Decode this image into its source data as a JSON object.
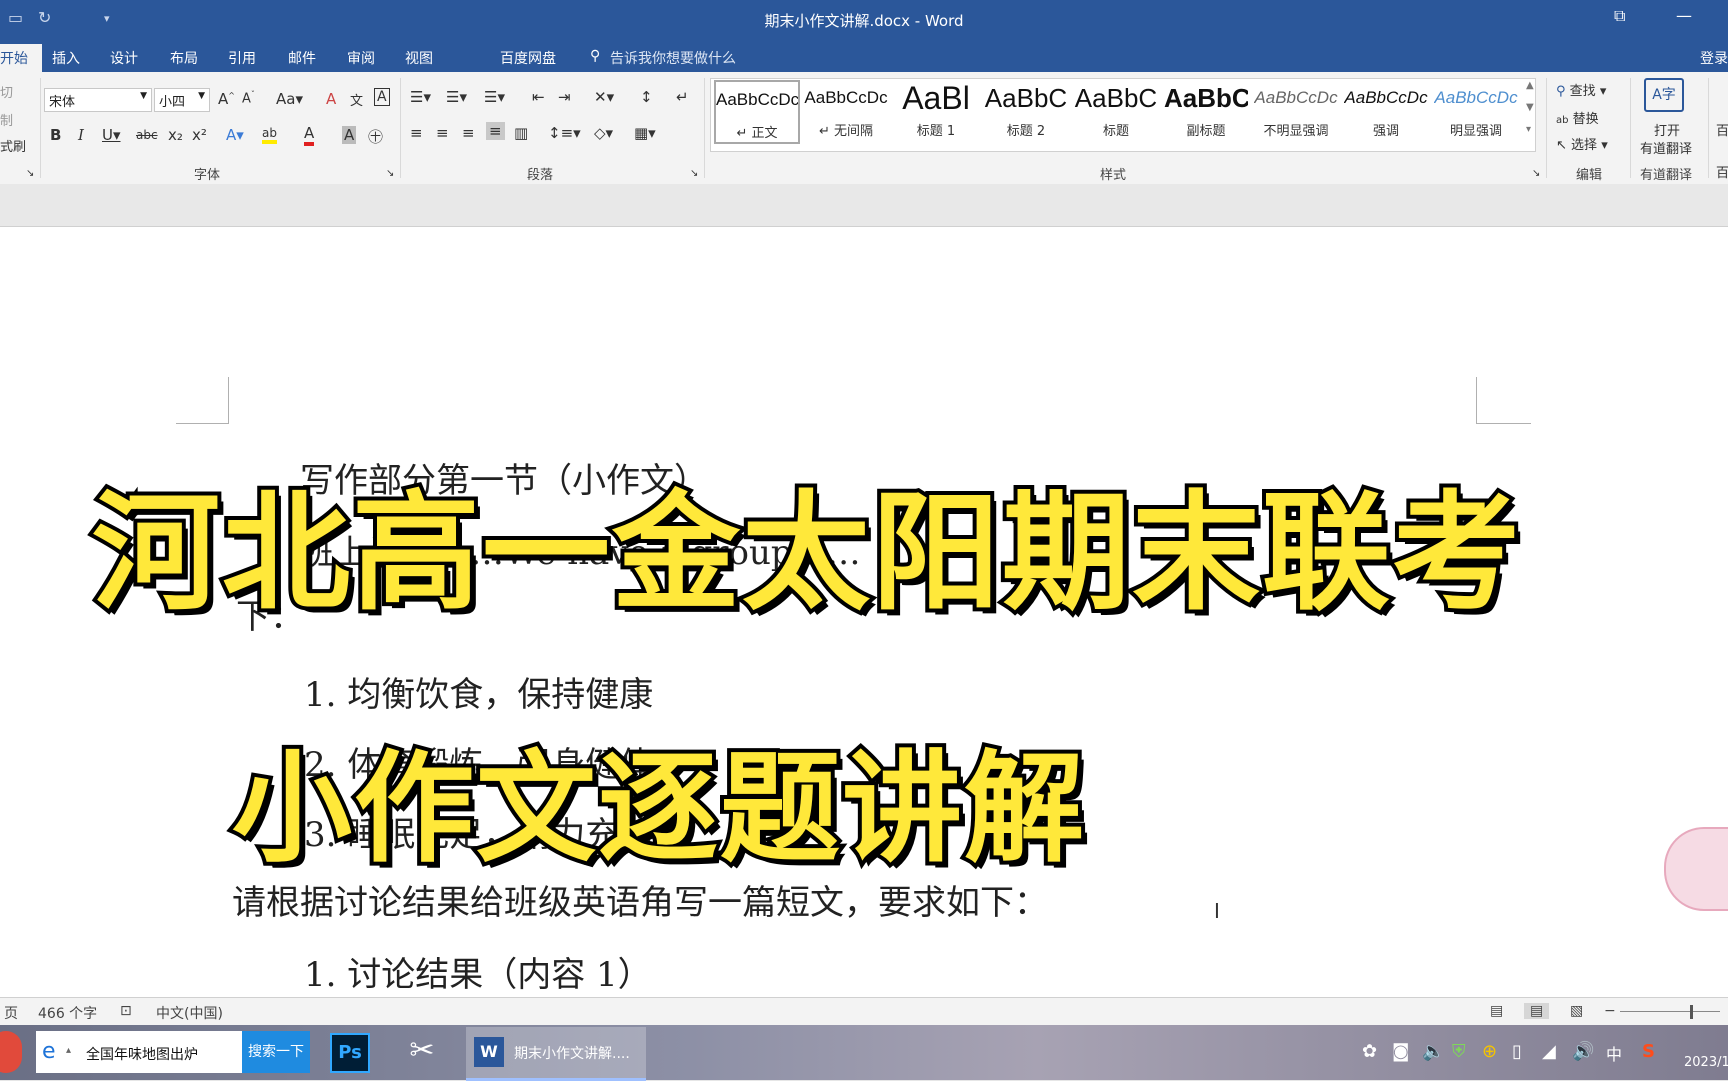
{
  "window": {
    "title": "期末小作文讲解.docx - Word"
  },
  "tabs": [
    {
      "label": "开始",
      "active": true
    },
    {
      "label": "插入"
    },
    {
      "label": "设计"
    },
    {
      "label": "布局"
    },
    {
      "label": "引用"
    },
    {
      "label": "邮件"
    },
    {
      "label": "审阅"
    },
    {
      "label": "视图"
    },
    {
      "label": "百度网盘"
    }
  ],
  "tell_me": "告诉我你想要做什么",
  "login": "登录",
  "clipboard": {
    "cut": "切",
    "copy": "制",
    "painter": "式刷"
  },
  "font": {
    "name": "宋体",
    "size": "小四",
    "group_label": "字体"
  },
  "paragraph": {
    "group_label": "段落"
  },
  "styles": {
    "group_label": "样式",
    "items": [
      {
        "preview": "AaBbCcDc",
        "name": "↵ 正文"
      },
      {
        "preview": "AaBbCcDc",
        "name": "↵ 无间隔"
      },
      {
        "preview": "AaBl",
        "name": "标题 1"
      },
      {
        "preview": "AaBbC",
        "name": "标题 2"
      },
      {
        "preview": "AaBbC",
        "name": "标题"
      },
      {
        "preview": "AaBbC",
        "name": "副标题"
      },
      {
        "preview": "AaBbCcDc",
        "name": "不明显强调"
      },
      {
        "preview": "AaBbCcDc",
        "name": "强调"
      },
      {
        "preview": "AaBbCcDc",
        "name": "明显强调"
      }
    ]
  },
  "editing": {
    "find": "查找",
    "replace": "替换",
    "select": "选择",
    "group_label": "编辑"
  },
  "youdao": {
    "line1": "打开",
    "line2": "有道翻译",
    "group_label": "有道翻译",
    "extra1": "百",
    "extra2": "百"
  },
  "document": {
    "line1": "写作部分第一节（小作文）",
    "line2": "班上计划……We have a group……",
    "line3": "下：",
    "item1": "1.   均衡饮食，保持健康",
    "item2": "2.   体育锻炼，强身健体",
    "item3": "3.   睡眠充足，精力充沛",
    "line4": "请根据讨论结果给班级英语角写一篇短文，要求如下：",
    "item4": "1.   讨论结果（内容 1）"
  },
  "overlay": {
    "title1": "河北高一金太阳期末联考",
    "title2": "小作文逐题讲解"
  },
  "status": {
    "page": "页",
    "words": "466 个字",
    "lang": "中文(中国)"
  },
  "taskbar": {
    "search_text": "全国年味地图出炉",
    "search_button": "搜索一下",
    "ps_label": "Ps",
    "word_task": "期末小作文讲解....",
    "ime": "中",
    "date": "2023/1"
  },
  "colors": {
    "word_blue": "#2b579a",
    "overlay_yellow": "#ffe83a",
    "search_blue": "#1f8be0"
  }
}
